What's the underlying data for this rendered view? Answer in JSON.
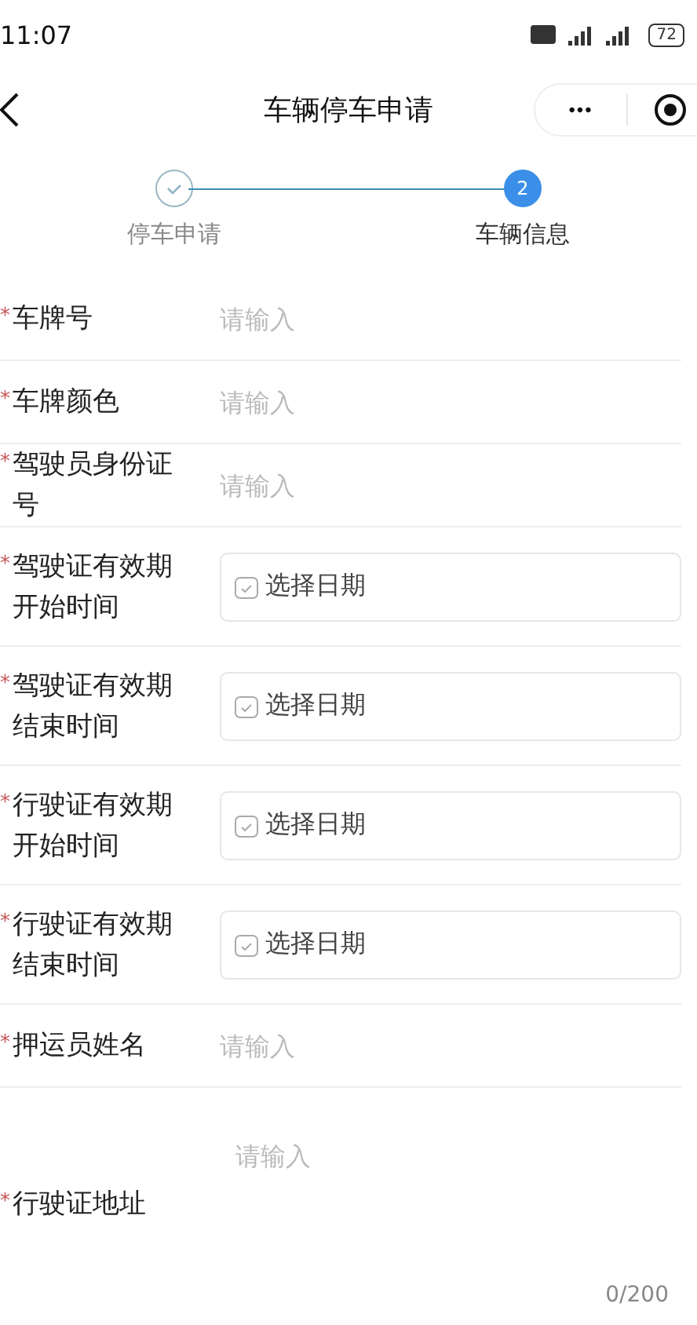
{
  "status_bar": {
    "time": "11:07",
    "battery": "72"
  },
  "nav": {
    "title": "车辆停车申请",
    "more": "•••"
  },
  "steps": [
    {
      "label": "停车申请",
      "completed": true,
      "selected": false
    },
    {
      "label": "车辆信息",
      "completed": false,
      "selected": true,
      "number": "2"
    }
  ],
  "fields": [
    {
      "kind": "text",
      "mark": "*",
      "label": "车牌号",
      "placeholder": "请输入"
    },
    {
      "kind": "text",
      "mark": "*",
      "label": "车牌颜色",
      "placeholder": "请输入"
    },
    {
      "kind": "text",
      "mark": "*",
      "label": "驾驶员身份证号",
      "placeholder": "请输入"
    },
    {
      "kind": "date",
      "mark": "*",
      "label": "驾驶证有效期开始时间",
      "placeholder": "选择日期"
    },
    {
      "kind": "date",
      "mark": "*",
      "label": "驾驶证有效期结束时间",
      "placeholder": "选择日期"
    },
    {
      "kind": "date",
      "mark": "*",
      "label": "行驶证有效期开始时间",
      "placeholder": "选择日期"
    },
    {
      "kind": "date",
      "mark": "*",
      "label": "行驶证有效期结束时间",
      "placeholder": "选择日期"
    },
    {
      "kind": "text",
      "mark": "*",
      "label": "押运员姓名",
      "placeholder": "请输入"
    },
    {
      "kind": "textarea",
      "mark": "*",
      "label": "行驶证地址",
      "placeholder": "请输入",
      "counter": "0/200"
    }
  ]
}
